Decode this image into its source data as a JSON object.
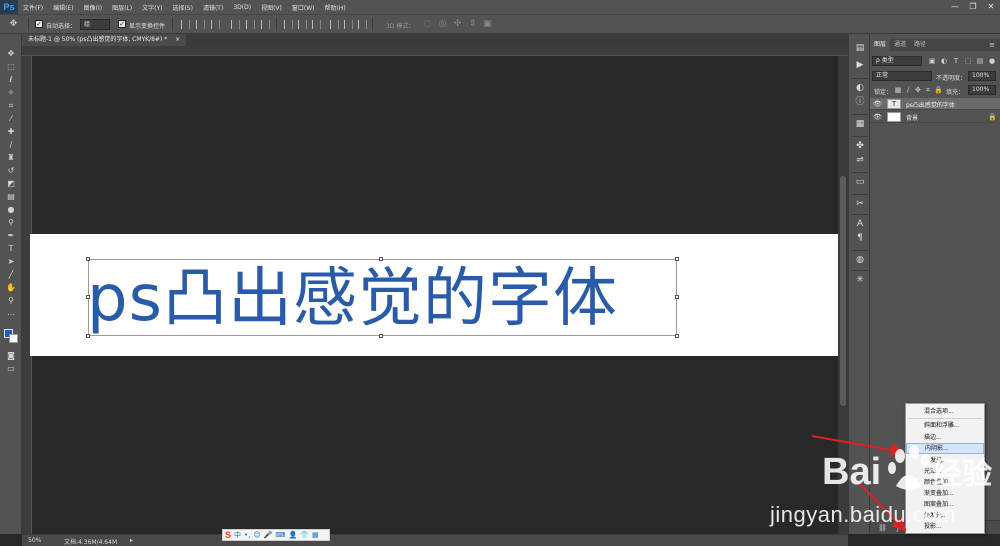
{
  "menubar": {
    "app_logo": "Ps",
    "items": [
      "文件(F)",
      "编辑(E)",
      "图像(I)",
      "图层(L)",
      "文字(Y)",
      "选择(S)",
      "滤镜(T)",
      "3D(D)",
      "视图(V)",
      "窗口(W)",
      "帮助(H)"
    ],
    "minimize": "—",
    "restore": "❐",
    "close": "✕"
  },
  "options": {
    "auto_select_label": "自动选择：",
    "auto_select_value": "组",
    "show_transform_label": "显示变换控件",
    "mode_3d_label": "3D 模式："
  },
  "document": {
    "tab_title": "未标题-1 @ 50% (ps凸出感觉的字体, CMYK/8#) *",
    "tab_close": "×",
    "canvas_text": "ps凸出感觉的字体"
  },
  "status": {
    "zoom": "50%",
    "doc_info": "文档:4.36M/4.64M",
    "arrow": "▸"
  },
  "ime": {
    "logo": "S",
    "items": [
      "中",
      "•,",
      "☺",
      "🎤",
      "⌨",
      "👤",
      "👕",
      "▦"
    ]
  },
  "layers_panel": {
    "tabs": [
      "图层",
      "通道",
      "路径"
    ],
    "filter_label": "ρ 类型",
    "blend_mode": "正常",
    "opacity_label": "不透明度：",
    "opacity_value": "100%",
    "lock_label": "锁定：",
    "fill_label": "填充：",
    "fill_value": "100%",
    "layers": [
      {
        "name": "ps凸出感觉的字体",
        "thumb": "T",
        "selected": true
      },
      {
        "name": "背景",
        "thumb": "",
        "selected": false
      }
    ]
  },
  "context_menu": {
    "items": [
      "混合选项...",
      "斜面和浮雕...",
      "描边...",
      "内阴影...",
      "内发光...",
      "光泽...",
      "颜色叠加...",
      "渐变叠加...",
      "图案叠加...",
      "外发光...",
      "投影..."
    ],
    "hover_index": 3
  },
  "watermark": {
    "brand_left": "Bai",
    "brand_right": "经验",
    "url": "jingyan.baidu.com"
  },
  "colors": {
    "text_blue": "#2a5ba8",
    "annotation_red": "#e02020",
    "panel_gray": "#535353"
  }
}
